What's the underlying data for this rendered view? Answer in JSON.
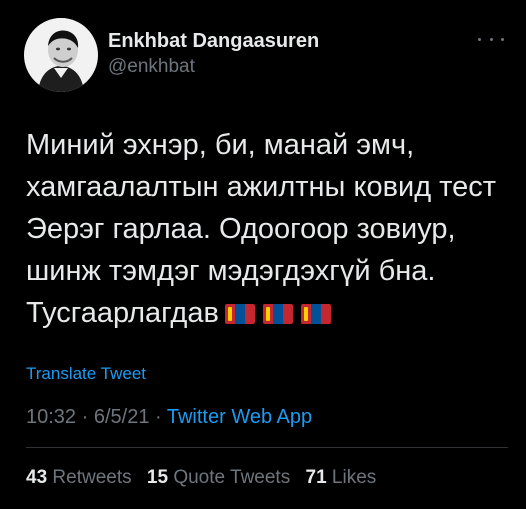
{
  "author": {
    "display_name": "Enkhbat Dangaasuren",
    "handle": "@enkhbat",
    "avatar_icon": "profile-photo"
  },
  "more_icon": "more-horizontal-icon",
  "tweet": {
    "line1": "Миний эхнэр, би, манай эмч,",
    "line2": "хамгаалалтын ажилтны ковид тест",
    "line3": "Эерэг гарлаа. Одоогоор зовиур,",
    "line4": "шинж тэмдэг мэдэгдэхгүй бна.",
    "line5": "Тусгаарлагдав",
    "emoji": [
      "flag-mongolia",
      "flag-mongolia",
      "flag-mongolia"
    ]
  },
  "translate_label": "Translate Tweet",
  "meta": {
    "time": "10:32",
    "separator1": " · ",
    "date": "6/5/21",
    "separator2": " · ",
    "app": "Twitter Web App"
  },
  "stats": {
    "retweets_count": "43",
    "retweets_label": "Retweets",
    "quotes_count": "15",
    "quotes_label": "Quote Tweets",
    "likes_count": "71",
    "likes_label": "Likes"
  },
  "colors": {
    "background": "#000000",
    "text": "#e7e9ea",
    "secondary": "#6e767d",
    "link": "#1d9bf0",
    "divider": "#2f3336"
  }
}
